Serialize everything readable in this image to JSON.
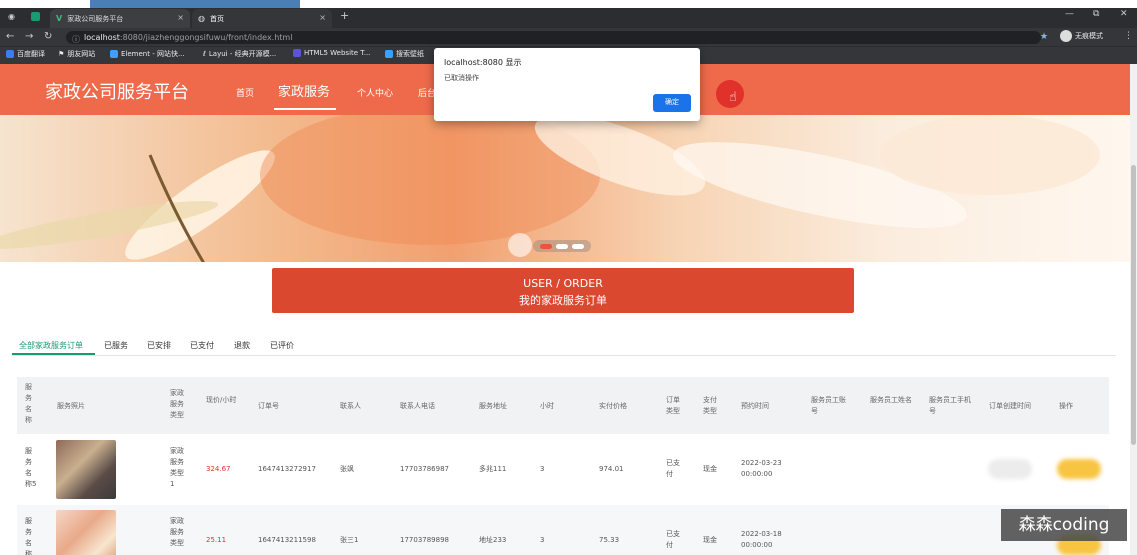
{
  "browser": {
    "tabs": [
      {
        "title": "家政公司服务平台",
        "favicon_color": "#40b883"
      },
      {
        "title": "首页",
        "favicon_color": "#9aa0a6"
      }
    ],
    "new_tab": "+",
    "close": "×",
    "window_controls": [
      "—",
      "⧉",
      "✕"
    ],
    "url_host": "localhost",
    "url_rest": ":8080/jiazhenggongsifuwu/front/index.html",
    "incognito_label": "无痕模式",
    "bookmarks": [
      {
        "label": "百度翻译",
        "color": "#3b7bf6"
      },
      {
        "label": "朋友网站",
        "color": "#ffffff"
      },
      {
        "label": "Element - 网站快...",
        "color": "#409eff"
      },
      {
        "label": "Layui - 经典开源模...",
        "color": "#ffffff"
      },
      {
        "label": "HTML5 Website T...",
        "color": "#5a55d6"
      },
      {
        "label": "搜索壁纸",
        "color": "#3aa0ff"
      }
    ]
  },
  "header": {
    "logo": "家政公司服务平台",
    "nav": [
      "首页",
      "家政服务",
      "个人中心",
      "后台"
    ],
    "active_nav": "家政服务",
    "color": "#ef6a4b"
  },
  "banner": {
    "dots": 3,
    "active_dot": 0
  },
  "order_title": {
    "en": "USER / ORDER",
    "zh": "我的家政服务订单"
  },
  "filter_tabs": [
    "全部家政服务订单",
    "已服务",
    "已安排",
    "已支付",
    "退款",
    "已评价"
  ],
  "active_filter": "全部家政服务订单",
  "table": {
    "headers": [
      "服务名称",
      "服务照片",
      "家政服务类型",
      "现价/小时",
      "订单号",
      "联系人",
      "联系人电话",
      "服务地址",
      "小时",
      "实付价格",
      "订单类型",
      "支付类型",
      "预约时间",
      "服务员工账号",
      "服务员工姓名",
      "服务员工手机号",
      "订单创建时间",
      "操作"
    ],
    "rows": [
      {
        "name": "服务名称5",
        "type": "家政服务类型1",
        "price": "324.67",
        "order_no": "1647413272917",
        "contact": "张飒",
        "phone": "17703786987",
        "address": "多兆111",
        "hours": "3",
        "paid": "974.01",
        "order_type": "已支付",
        "pay_type": "现金",
        "appoint": "2022-03-23 00:00:00"
      },
      {
        "name": "服务名称",
        "type": "家政服务类型",
        "price": "25.11",
        "order_no": "1647413211598",
        "contact": "张三1",
        "phone": "17703789898",
        "address": "地址233",
        "hours": "3",
        "paid": "75.33",
        "order_type": "已支付",
        "pay_type": "现金",
        "appoint": "2022-03-18 00:00:00"
      }
    ]
  },
  "dialog": {
    "title": "localhost:8080 显示",
    "message": "已取消操作",
    "ok": "确定"
  },
  "watermark": "森森coding"
}
